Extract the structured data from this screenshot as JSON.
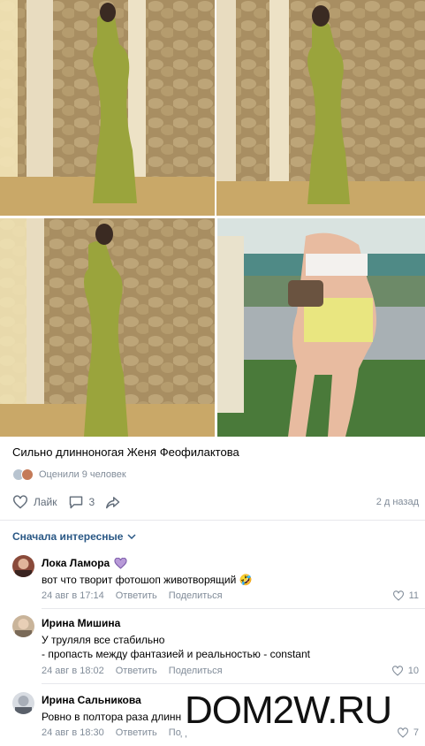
{
  "post": {
    "text": "Сильно длинноногая Женя Феофилактова",
    "likers_text": "Оценили 9 человек",
    "like_label": "Лайк",
    "comments_count": "3",
    "time_ago": "2 д назад"
  },
  "sort_label": "Сначала интересные",
  "comments": [
    {
      "name": "Лока Ламора",
      "text": "вот что творит фотошоп животворящий 🤣",
      "date": "24 авг в 17:14",
      "reply": "Ответить",
      "share": "Поделиться",
      "likes": "11"
    },
    {
      "name": "Ирина Мишина",
      "line1": "У труляля все стабильно",
      "line2": "- пропасть между фантазией и реальностью - constant",
      "date": "24 авг в 18:02",
      "reply": "Ответить",
      "share": "Поделиться",
      "likes": "10"
    },
    {
      "name": "Ирина Сальникова",
      "text": "Ровно в полтора раза длиннее",
      "date": "24 авг в 18:30",
      "reply": "Ответить",
      "share": "Поделиться",
      "likes": "7"
    }
  ],
  "watermark": "DOM2W.RU",
  "colors": {
    "link": "#2a5885",
    "muted": "#818c99",
    "divider": "#e7e8ec",
    "dress": "#9aa43c"
  }
}
